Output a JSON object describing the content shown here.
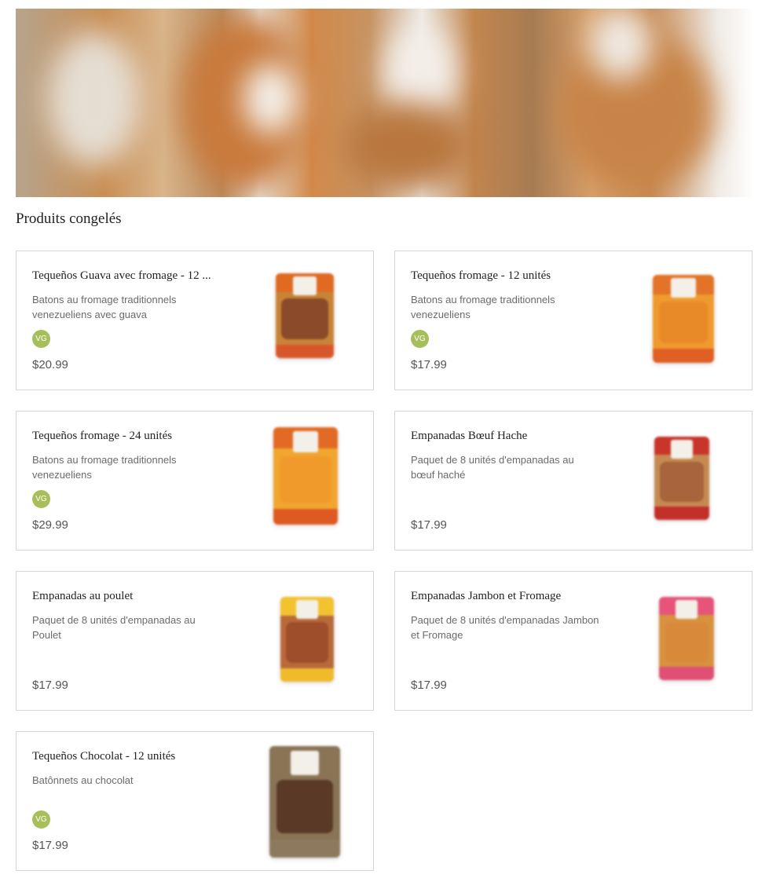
{
  "section": {
    "title": "Produits congelés"
  },
  "products": [
    {
      "name": "Tequeños Guava avec fromage - 12 ...",
      "description": "Batons au fromage traditionnels venezueliens avec guava",
      "badge": "VG",
      "price": "$20.99",
      "image": "tequenos-guava-pouch",
      "pouch_colors": [
        "#e06a22",
        "#c98337",
        "#d8572a"
      ]
    },
    {
      "name": "Tequeños fromage - 12 unités",
      "description": "Batons au fromage traditionnels venezueliens",
      "badge": "VG",
      "price": "$17.99",
      "image": "tequenos-cheese-pouch",
      "pouch_colors": [
        "#e27327",
        "#ef9a2e",
        "#e05f23"
      ]
    },
    {
      "name": "Tequeños fromage - 24 unités",
      "description": "Batons au fromage traditionnels venezueliens",
      "badge": "VG",
      "price": "$29.99",
      "image": "tequenos-cheese-24-pouch",
      "pouch_colors": [
        "#e26a24",
        "#f0a62f",
        "#df5a22"
      ]
    },
    {
      "name": "Empanadas Bœuf Hache",
      "description": "Paquet de 8 unités d'empanadas au bœuf haché",
      "badge": "",
      "price": "$17.99",
      "image": "empanadas-beef-pouch",
      "pouch_colors": [
        "#c8352a",
        "#c58a52",
        "#c3302a"
      ]
    },
    {
      "name": "Empanadas au poulet",
      "description": "Paquet de 8 unités d'empanadas au Poulet",
      "badge": "",
      "price": "$17.99",
      "image": "empanadas-chicken-pouch",
      "pouch_colors": [
        "#f2c230",
        "#b86a3a",
        "#efbb2a"
      ]
    },
    {
      "name": "Empanadas Jambon et Fromage",
      "description": "Paquet de 8 unités d'empanadas Jambon et Fromage",
      "badge": "",
      "price": "$17.99",
      "image": "empanadas-ham-cheese-pouch",
      "pouch_colors": [
        "#e6547a",
        "#d7923f",
        "#e04f74"
      ]
    },
    {
      "name": "Tequeños Chocolat - 12 unités",
      "description": "Batônnets au chocolat",
      "badge": "VG",
      "price": "$17.99",
      "image": "tequenos-chocolate-pouch",
      "pouch_colors": [
        "#8a7456",
        "#5a3a26",
        "#8d7a5e"
      ]
    }
  ]
}
